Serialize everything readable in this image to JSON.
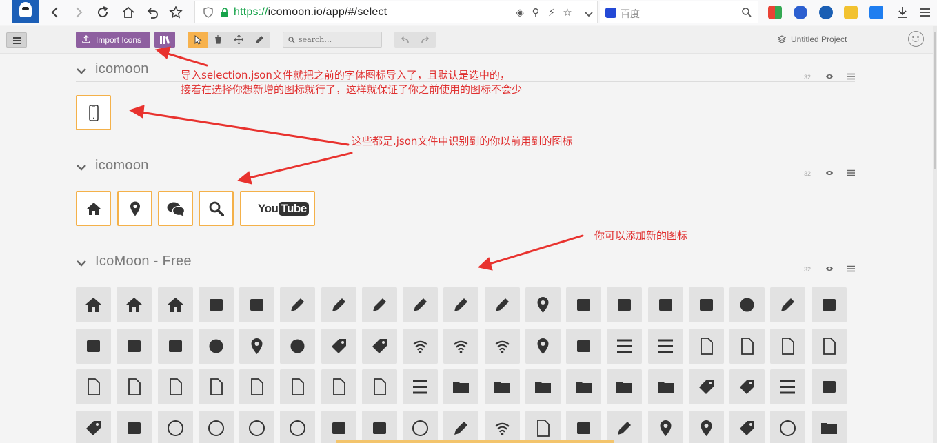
{
  "browser": {
    "url_scheme": "https://",
    "url_rest": "icomoon.io/app/#/select",
    "search_placeholder": "百度",
    "nav": {
      "back": "back",
      "forward": "forward",
      "reload": "reload",
      "home": "home",
      "undo_close": "undo",
      "bookmark": "star"
    }
  },
  "toolbar": {
    "import_label": "Import Icons",
    "search_placeholder": "search…",
    "project_name": "Untitled Project"
  },
  "sets": [
    {
      "title": "icomoon",
      "size": "32"
    },
    {
      "title": "icomoon",
      "size": "32"
    },
    {
      "title": "IcoMoon - Free",
      "size": "32"
    }
  ],
  "selected_icons_1": [
    "mobile-icon"
  ],
  "selected_icons_2": [
    "home-icon",
    "location-icon",
    "bubbles-icon",
    "search-icon",
    "youtube-icon"
  ],
  "youtube_text": {
    "you": "You",
    "tube": "Tube"
  },
  "free_icons": [
    [
      "home",
      "home2",
      "home3",
      "office",
      "newspaper",
      "pencil",
      "pencil2",
      "quill",
      "pen",
      "blog",
      "eyedropper",
      "droplet",
      "paint-format",
      "image",
      "images",
      "camera",
      "headphones",
      "music",
      "play"
    ],
    [
      "film",
      "video-camera",
      "dice",
      "pacman",
      "spades",
      "clubs",
      "diamonds",
      "bullhorn",
      "connection",
      "podcast",
      "feed",
      "mic",
      "book",
      "books",
      "library",
      "file-text",
      "profile",
      "file-empty",
      "files-empty"
    ],
    [
      "file-text2",
      "file-picture",
      "file-music",
      "file-play",
      "file-video",
      "file-zip",
      "copy",
      "paste",
      "stack",
      "folder",
      "folder-open",
      "folder-plus",
      "folder-minus",
      "folder-download",
      "folder-upload",
      "price-tag",
      "price-tags",
      "barcode",
      "qrcode"
    ],
    [
      "ticket",
      "cart",
      "coin-dollar",
      "coin-euro",
      "coin-pound",
      "coin-yen",
      "credit-card",
      "calculator",
      "lifebuoy",
      "phone",
      "phone-hang-up",
      "address-book",
      "envelop",
      "pushpin",
      "location",
      "location2",
      "compass",
      "compass2",
      "map"
    ]
  ],
  "annotations": {
    "note1_line1": "导入selection.json文件就把之前的字体图标导入了，且默认是选中的，",
    "note1_line2": "接着在选择你想新增的图标就行了，这样就保证了你之前使用的图标不会少",
    "note2": "这些都是.json文件中识别到的你以前用到的图标",
    "note3": "你可以添加新的图标"
  },
  "colors": {
    "accent_purple": "#8e5fa0",
    "selection_orange": "#f4b14a",
    "annotation_red": "#e03030",
    "url_green": "#17a34a"
  }
}
